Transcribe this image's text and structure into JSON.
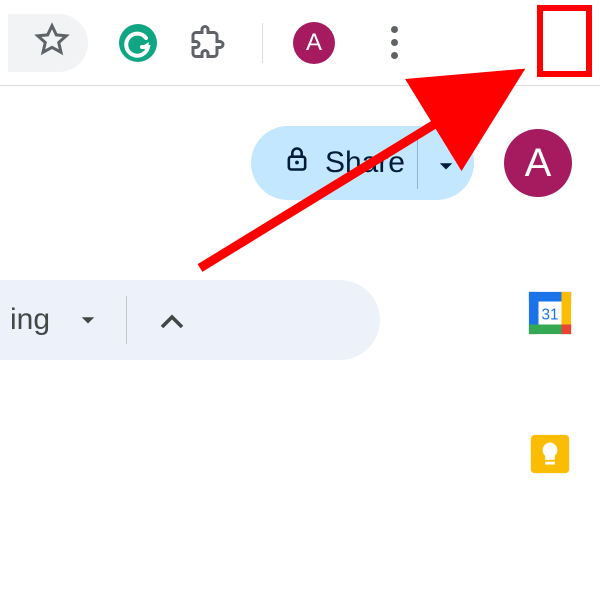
{
  "browser": {
    "avatar_initial": "A",
    "avatar_color": "#a61b60"
  },
  "header": {
    "share_label": "Share",
    "avatar_initial": "A"
  },
  "toolbar": {
    "mode_label_tail": "ing"
  },
  "side": {
    "calendar_day": "31"
  },
  "annotation": {
    "highlight_color": "#ff0000"
  }
}
